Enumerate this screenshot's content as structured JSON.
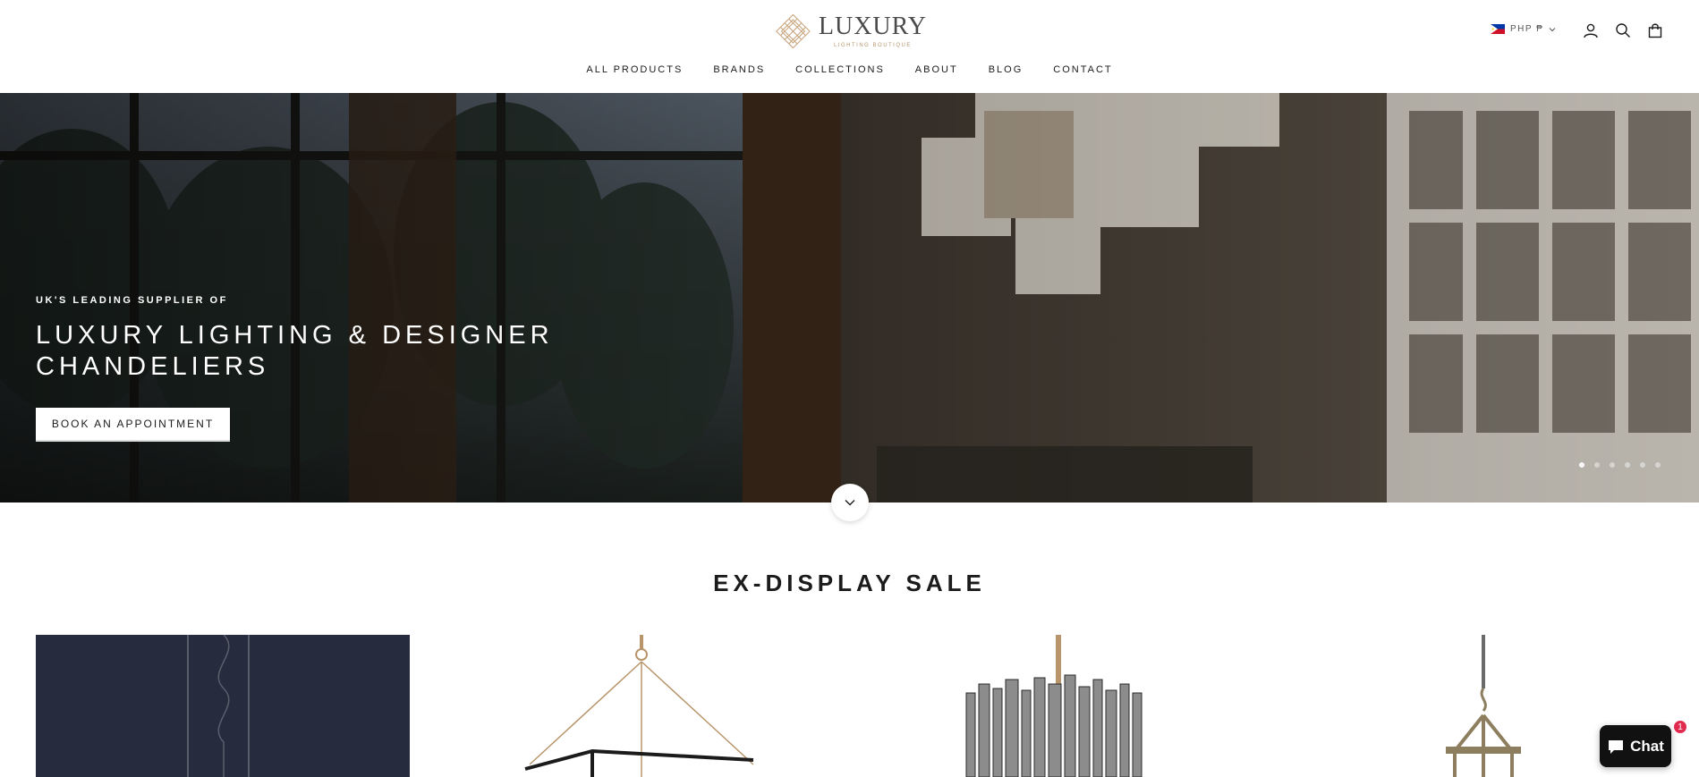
{
  "header": {
    "logo_word": "LUXURY",
    "logo_sub": "LIGHTING BOUTIQUE",
    "currency": "PHP ₱",
    "icons": [
      "account-icon",
      "search-icon",
      "cart-icon"
    ]
  },
  "nav": {
    "items": [
      "ALL PRODUCTS",
      "BRANDS",
      "COLLECTIONS",
      "ABOUT",
      "BLOG",
      "CONTACT"
    ]
  },
  "hero": {
    "eyebrow": "UK'S LEADING SUPPLIER OF",
    "title_line1": "LUXURY LIGHTING & DESIGNER",
    "title_line2": "CHANDELIERS",
    "button": "BOOK AN APPOINTMENT",
    "slides_count": 6,
    "active_slide": 1
  },
  "section": {
    "title": "EX-DISPLAY SALE"
  },
  "chat": {
    "label": "Chat",
    "badge": "1"
  },
  "colors": {
    "accent_gold": "#b8956a",
    "text": "#1c1b1b",
    "chat_badge": "#e02b4f"
  }
}
